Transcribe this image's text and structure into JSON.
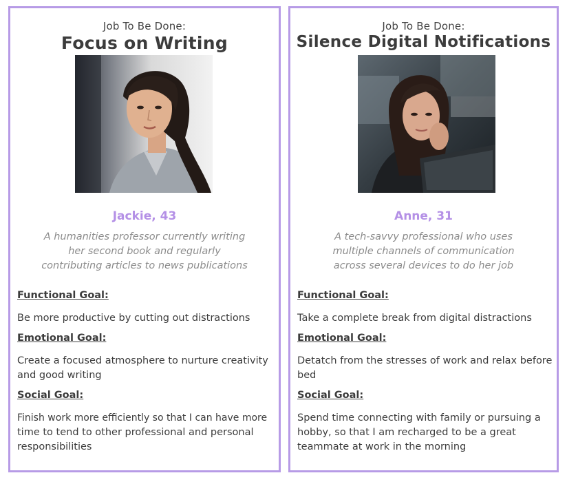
{
  "personas": [
    {
      "job_label": "Job To Be Done:",
      "job_title": "Focus on Writing",
      "photo_icon": "woman-portrait-photo",
      "name": "Jackie, 43",
      "description_lines": [
        "A humanities professor currently writing",
        "her second book and regularly",
        "contributing articles to news publications"
      ],
      "functional_heading": "Functional Goal:",
      "functional_lines": [
        "Be more productive by cutting out distractions"
      ],
      "emotional_heading": "Emotional Goal:",
      "emotional_lines": [
        "Create a focused atmosphere to nurture creativity",
        "and good writing"
      ],
      "social_heading": "Social Goal:",
      "social_lines": [
        "Finish work more efficiently so that I can have more",
        "time to tend to other professional and personal",
        "responsibilities"
      ]
    },
    {
      "job_label": "Job To Be Done:",
      "job_title": "Silence Digital Notifications",
      "photo_icon": "woman-at-computer-photo",
      "name": "Anne, 31",
      "description_lines": [
        "A tech-savvy professional who uses",
        "multiple channels of communication",
        "across several devices to do her job"
      ],
      "functional_heading": "Functional Goal:",
      "functional_lines": [
        "Take a complete break from digital distractions"
      ],
      "emotional_heading": "Emotional Goal:",
      "emotional_lines": [
        "Detatch from the stresses of work and relax before",
        "bed"
      ],
      "social_heading": "Social Goal:",
      "social_lines": [
        "Spend time connecting with family or pursuing a",
        "hobby, so that I am recharged to be a great",
        "teammate at work in the morning"
      ]
    }
  ],
  "colors": {
    "border": "#b79be6",
    "accent_name": "#b490e6",
    "text": "#3c3c3c",
    "muted": "#8c8c8c"
  }
}
